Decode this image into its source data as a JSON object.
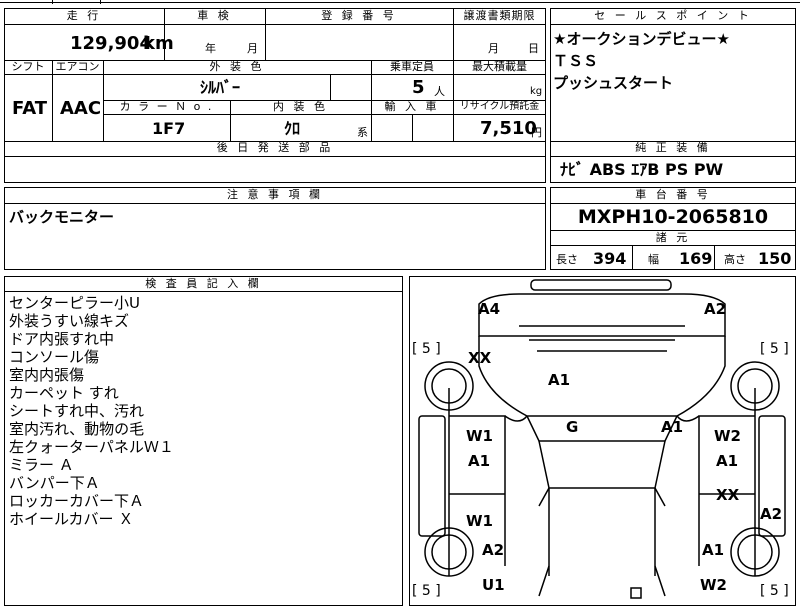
{
  "header": {
    "mileage_label": "走 行",
    "shaken_label": "車 検",
    "reg_label": "登 録 番 号",
    "transfer_label": "譲渡書類期限",
    "mileage_value": "129,904",
    "mileage_unit": "km",
    "shaken_year_unit": "年",
    "shaken_month_unit": "月",
    "transfer_month_unit": "月",
    "transfer_day_unit": "日"
  },
  "mid": {
    "shift_label": "シフト",
    "ac_label": "エアコン",
    "exterior_color_label": "外 装 色",
    "capacity_label": "乗車定員",
    "max_load_label": "最大積載量",
    "shift_value": "FAT",
    "ac_value": "AAC",
    "exterior_color_value": "ｼﾙﾊﾞｰ",
    "capacity_value": "5",
    "capacity_unit": "人",
    "max_load_unit": "kg",
    "color_no_label": "カ ラ ー Ｎ o .",
    "interior_color_label": "内 装 色",
    "import_label": "輸 入 車",
    "recycle_label": "リサイクル預託金",
    "color_no_value": "1F7",
    "interior_color_value": "ｸﾛ",
    "interior_color_suffix": "系",
    "recycle_value": "7,510",
    "recycle_unit": "円",
    "later_parts_label": "後 日 発 送 部 品"
  },
  "sales": {
    "label": "セ ー ル ス ポ イ ン ト",
    "lines": [
      "★オークションデビュー★",
      "ＴＳＳ",
      "プッシュスタート"
    ]
  },
  "equipment": {
    "label": "純 正 装 備",
    "value": "ﾅﾋﾞ ABS ｴｱB PS PW"
  },
  "notes": {
    "label": "注 意 事 項 欄",
    "value": "バックモニター"
  },
  "chassis": {
    "label": "車 台 番 号",
    "value": "MXPH10-2065810"
  },
  "specs": {
    "label": "諸 元",
    "length_label": "長さ",
    "length_value": "394",
    "width_label": "幅",
    "width_value": "169",
    "height_label": "高さ",
    "height_value": "150"
  },
  "inspector": {
    "label": "検 査 員 記 入 欄",
    "lines": [
      "センターピラー小U",
      "外装うすい線キズ",
      "ドア内張すれ中",
      "コンソール傷",
      "室内内張傷",
      "カーペット すれ",
      "シートすれ中、汚れ",
      "室内汚れ、動物の毛",
      "左クォーターパネルＷ１",
      "ミラー Ａ",
      "バンパー下Ａ",
      "ロッカーカバー下Ａ",
      "ホイールカバー Ｘ"
    ]
  },
  "diagram": {
    "marks": {
      "front_left_corner": "A4",
      "front_right_corner": "A2",
      "hood_left": "XX",
      "hood_center": "A1",
      "roof": "G",
      "right_pillar": "A1",
      "left_front_door_1": "W1",
      "left_front_door_2": "A1",
      "right_front_door_1": "W2",
      "right_front_door_2": "A1",
      "right_rear_door": "XX",
      "left_rear_door": "W1",
      "right_rear_edge": "A2",
      "left_rear_fender": "A2",
      "right_rear_fender": "A1",
      "rear_bottom_left": "U1",
      "rear_bottom_right": "W2"
    },
    "tire_front_left": "5",
    "tire_front_right": "5",
    "tire_rear_left": "5",
    "tire_rear_right": "5"
  }
}
